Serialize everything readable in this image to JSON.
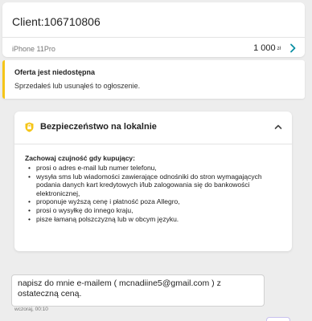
{
  "header": {
    "client_title": "Client:106710806",
    "product_name": "iPhone 11Pro",
    "price_value": "1 000",
    "price_currency": "zł",
    "chevron_icon": "chevron-right-icon",
    "accent_color": "#0a8fa3"
  },
  "alert": {
    "title": "Oferta jest niedostępna",
    "text": "Sprzedałeś lub usunąłeś to ogłoszenie.",
    "accent_color": "#f5c518"
  },
  "security": {
    "icon": "shield-icon",
    "title": "Bezpieczeństwo na lokalnie",
    "toggle_icon": "chevron-up-icon",
    "intro": "Zachowaj czujność gdy kupujący:",
    "tips": [
      "prosi o adres e-mail lub numer telefonu,",
      "wysyła sms lub wiadomości zawierające odnośniki do stron wymagających podania danych kart kredytowych i/lub zalogowania się do bankowości elektronicznej,",
      "proponuje wyższą cenę i płatność poza Allegro,",
      "prosi o wysyłkę do innego kraju,",
      "pisze łamaną polszczyzną lub w obcym języku."
    ]
  },
  "message": {
    "text": "napisz do mnie e-mailem ( mcnadiine5@gmail.com ) z ostateczną ceną.",
    "time": "wczoraj, 00:10"
  }
}
